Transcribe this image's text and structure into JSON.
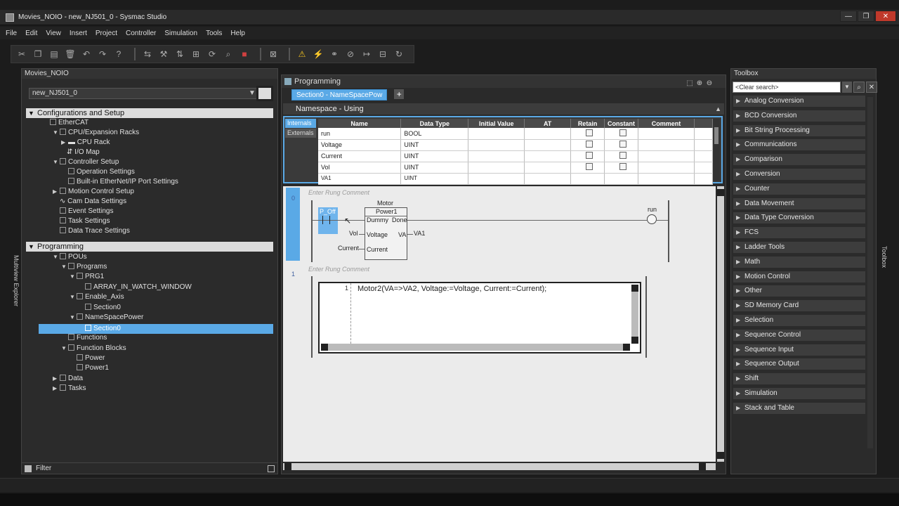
{
  "window": {
    "title": "Movies_NOIO - new_NJ501_0 - Sysmac Studio"
  },
  "menu": [
    "File",
    "Edit",
    "View",
    "Insert",
    "Project",
    "Controller",
    "Simulation",
    "Tools",
    "Help"
  ],
  "explorer": {
    "title": "Movies_NOIO",
    "device": "new_NJ501_0",
    "side_label": "Multiview Explorer",
    "config_section": "Configurations and Setup",
    "config_items": [
      "EtherCAT",
      "CPU/Expansion Racks",
      "CPU Rack",
      "I/O Map",
      "Controller Setup",
      "Operation Settings",
      "Built-in EtherNet/IP Port Settings",
      "Motion Control Setup",
      "Cam Data Settings",
      "Event Settings",
      "Task Settings",
      "Data Trace Settings"
    ],
    "programming_section": "Programming",
    "prog_items": [
      "POUs",
      "Programs",
      "PRG1",
      "ARRAY_IN_WATCH_WINDOW",
      "Enable_Axis",
      "Section0",
      "NameSpacePower",
      "Section0",
      "Functions",
      "Function Blocks",
      "Power",
      "Power1",
      "Data",
      "Tasks"
    ],
    "filter": "Filter"
  },
  "programming": {
    "title": "Programming",
    "tab": "Section0 - NameSpacePow",
    "namespace_header": "Namespace - Using",
    "var_tabs": [
      "Internals",
      "Externals"
    ],
    "columns": [
      "Name",
      "Data Type",
      "Initial Value",
      "AT",
      "Retain",
      "Constant",
      "Comment"
    ],
    "rows": [
      {
        "name": "run",
        "type": "BOOL"
      },
      {
        "name": "Voltage",
        "type": "UINT"
      },
      {
        "name": "Current",
        "type": "UINT"
      },
      {
        "name": "Vol",
        "type": "UINT"
      },
      {
        "name": "VA1",
        "type": "UINT"
      }
    ],
    "rung0": {
      "num": "0",
      "comment": "Enter Rung Comment",
      "contact": "P_Off",
      "fb_instance": "Motor",
      "fb_type": "Power1",
      "in_dummy": "Dummy",
      "out_done": "Done",
      "in_voltage": "Voltage",
      "out_va": "VA",
      "va_var": "VA1",
      "vol_var": "Vol",
      "in_current": "Current",
      "cur_var": "Current",
      "coil": "run"
    },
    "rung1": {
      "num": "1",
      "comment": "Enter Rung Comment",
      "line": "1",
      "code": "Motor2(VA=>VA2, Voltage:=Voltage, Current:=Current);"
    }
  },
  "toolbox": {
    "title": "Toolbox",
    "side_label": "Toolbox",
    "search": "<Clear search>",
    "items": [
      "Analog Conversion",
      "BCD Conversion",
      "Bit String Processing",
      "Communications",
      "Comparison",
      "Conversion",
      "Counter",
      "Data Movement",
      "Data Type Conversion",
      "FCS",
      "Ladder Tools",
      "Math",
      "Motion Control",
      "Other",
      "SD Memory Card",
      "Selection",
      "Sequence Control",
      "Sequence Input",
      "Sequence Output",
      "Shift",
      "Simulation",
      "Stack and Table"
    ]
  }
}
